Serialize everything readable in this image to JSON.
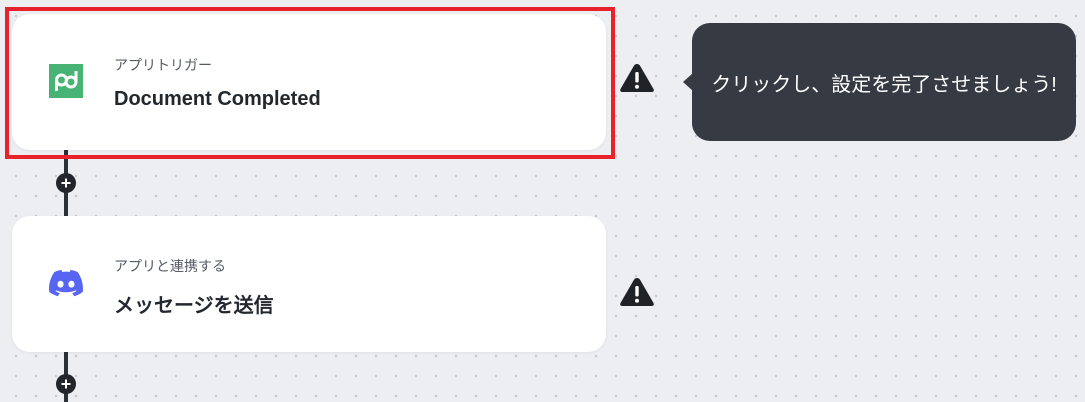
{
  "flow": {
    "steps": [
      {
        "subtitle": "アプリトリガー",
        "title": "Document Completed",
        "app_icon": "pandadoc-icon",
        "status_icon": "warning-icon",
        "highlighted": true
      },
      {
        "subtitle": "アプリと連携する",
        "title": "メッセージを送信",
        "app_icon": "discord-icon",
        "status_icon": "warning-icon",
        "highlighted": false
      }
    ],
    "add_step_icon": "plus-icon"
  },
  "tooltip": {
    "text": "クリックし、設定を完了させましょう!"
  },
  "colors": {
    "canvas_background": "#eceef2",
    "highlight_border": "#e8222b",
    "pandadoc_green": "#47b475",
    "discord_blurple": "#5865f2",
    "tooltip_background": "#363a42",
    "warning_icon": "#1f2227"
  }
}
